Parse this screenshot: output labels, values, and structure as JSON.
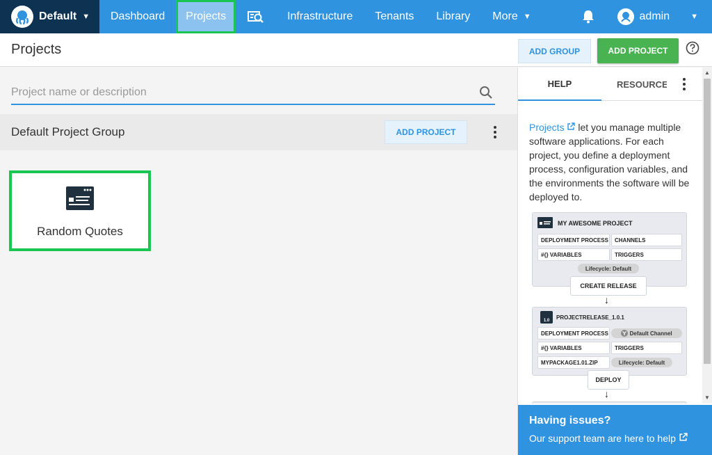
{
  "nav": {
    "space_name": "Default",
    "items": [
      "Dashboard",
      "Projects",
      "Infrastructure",
      "Tenants",
      "Library",
      "More"
    ],
    "user_name": "admin"
  },
  "header": {
    "title": "Projects",
    "add_group_label": "ADD GROUP",
    "add_project_label": "ADD PROJECT"
  },
  "search": {
    "placeholder": "Project name or description"
  },
  "group": {
    "title": "Default Project Group",
    "add_project_label": "ADD PROJECT"
  },
  "projects": [
    {
      "name": "Random Quotes"
    }
  ],
  "panel": {
    "tabs": [
      "HELP",
      "RESOURCES"
    ],
    "help_link": "Projects",
    "help_text": " let you manage multiple software applications. For each project, you define a deployment process, configuration variables, and the environments the software will be deployed to.",
    "diagram": {
      "project_title": "MY AWESOME PROJECT",
      "deployment_process": "DEPLOYMENT PROCESS",
      "channels": "CHANNELS",
      "variables": "VARIABLES",
      "triggers": "TRIGGERS",
      "lifecycle": "Lifecycle: Default",
      "create_release": "CREATE RELEASE",
      "release_title": "PROJECTRELEASE_1.0.1",
      "release_version": "1.0",
      "default_channel": "Default Channel",
      "package": "MYPACKAGE1.01.ZIP",
      "deploy": "DEPLOY",
      "var_symbol": "#{}"
    },
    "issues_title": "Having issues?",
    "issues_text": "Our support team are here to help"
  },
  "colors": {
    "nav_bg": "#2f93e0",
    "space_bg": "#0d3252",
    "primary": "#2f93e0",
    "success": "#48b350",
    "highlight": "#1ac653"
  },
  "icons": [
    "octopus-logo-icon",
    "caret-down-icon",
    "tasks-icon",
    "bell-icon",
    "user-avatar-icon",
    "help-circle-icon",
    "search-icon",
    "kebab-menu-icon",
    "project-icon",
    "external-link-icon"
  ]
}
